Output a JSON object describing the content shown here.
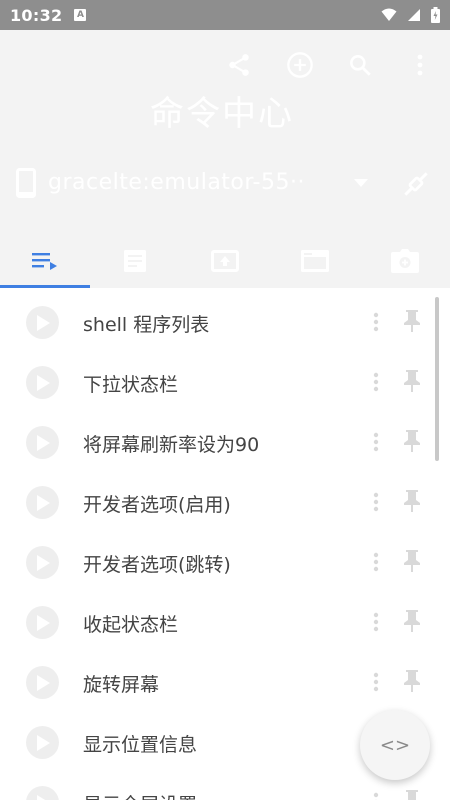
{
  "status_bar": {
    "time": "10:32",
    "notification_badge": "A"
  },
  "header": {
    "title": "命令中心",
    "device": "gracelte:emulator-55··",
    "toolbar_icons": [
      "share-icon",
      "add-circle-icon",
      "search-icon",
      "more-vert-icon"
    ],
    "tabs": [
      {
        "icon": "playlist-icon",
        "selected": true
      },
      {
        "icon": "document-icon",
        "selected": false
      },
      {
        "icon": "upload-screen-icon",
        "selected": false
      },
      {
        "icon": "window-icon",
        "selected": false
      },
      {
        "icon": "camera-icon",
        "selected": false
      }
    ]
  },
  "commands": [
    {
      "label": "shell 程序列表"
    },
    {
      "label": "下拉状态栏"
    },
    {
      "label": "将屏幕刷新率设为90"
    },
    {
      "label": "开发者选项(启用)"
    },
    {
      "label": "开发者选项(跳转)"
    },
    {
      "label": "收起状态栏"
    },
    {
      "label": "旋转屏幕"
    },
    {
      "label": "显示位置信息"
    },
    {
      "label": "显示全屏设置"
    }
  ],
  "fab": {
    "label": "<>",
    "icon": "code-icon"
  },
  "colors": {
    "accent": "#3f7fe2",
    "header_bg": "#f3f3f3",
    "status_bar": "#8e8e8e",
    "text": "#444444"
  }
}
